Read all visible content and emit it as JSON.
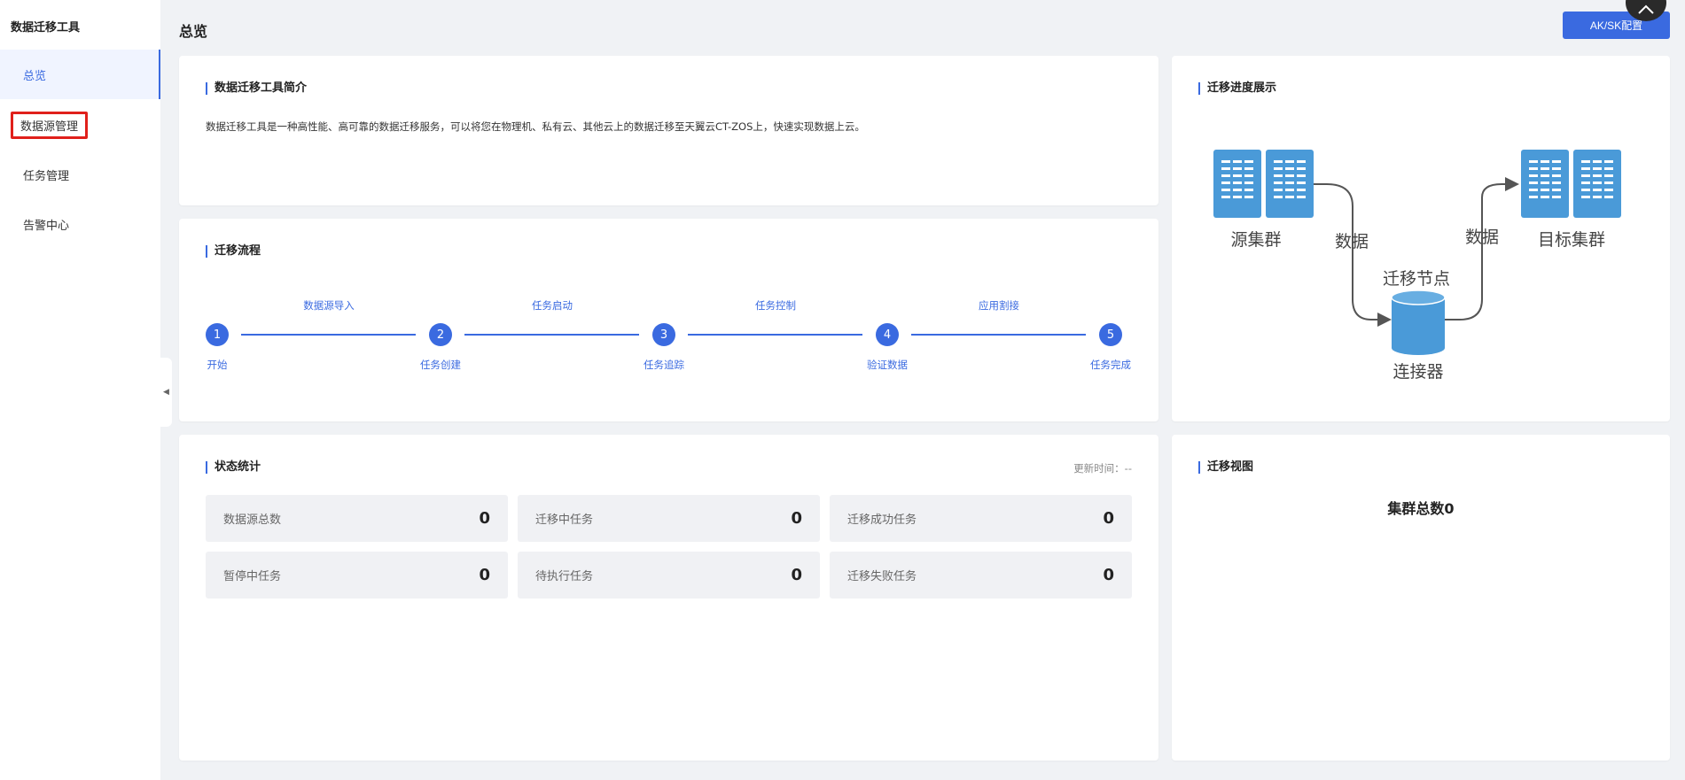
{
  "sidebar": {
    "brand": "数据迁移工具",
    "items": [
      {
        "label": "总览"
      },
      {
        "label": "数据源管理"
      },
      {
        "label": "任务管理"
      },
      {
        "label": "告警中心"
      }
    ],
    "collapse_icon": "◀"
  },
  "header": {
    "title": "总览",
    "aksk_label": "AK/SK配置"
  },
  "intro": {
    "title": "数据迁移工具简介",
    "text": "数据迁移工具是一种高性能、高可靠的数据迁移服务，可以将您在物理机、私有云、其他云上的数据迁移至天翼云CT-ZOS上，快速实现数据上云。"
  },
  "flow": {
    "title": "迁移流程",
    "steps": [
      {
        "num": "1",
        "label": "开始"
      },
      {
        "num": "2",
        "label": "任务创建"
      },
      {
        "num": "3",
        "label": "任务追踪"
      },
      {
        "num": "4",
        "label": "验证数据"
      },
      {
        "num": "5",
        "label": "任务完成"
      }
    ],
    "transitions": [
      "数据源导入",
      "任务启动",
      "任务控制",
      "应用割接"
    ]
  },
  "progress": {
    "title": "迁移进度展示",
    "source": "源集群",
    "target": "目标集群",
    "node": "迁移节点",
    "connector": "连接器",
    "data_left": "数据",
    "data_right": "数据"
  },
  "stats": {
    "title": "状态统计",
    "update_time": "更新时间：--",
    "items": [
      {
        "label": "数据源总数",
        "value": "0"
      },
      {
        "label": "迁移中任务",
        "value": "0"
      },
      {
        "label": "迁移成功任务",
        "value": "0"
      },
      {
        "label": "暂停中任务",
        "value": "0"
      },
      {
        "label": "待执行任务",
        "value": "0"
      },
      {
        "label": "迁移失败任务",
        "value": "0"
      }
    ]
  },
  "view": {
    "title": "迁移视图",
    "cluster_total": "集群总数0"
  },
  "colors": {
    "accent": "#3a6ae0",
    "highlight": "#e0201b",
    "server": "#4a9ad8"
  }
}
